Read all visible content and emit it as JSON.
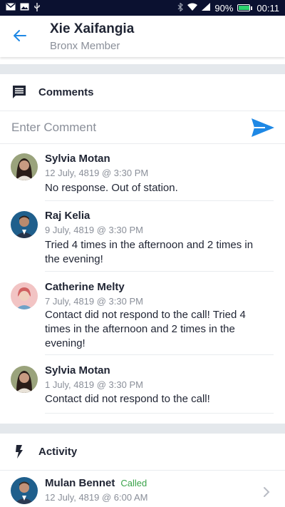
{
  "status_bar": {
    "battery": "90%",
    "time": "00:11",
    "icons": [
      "gmail-icon",
      "image-icon",
      "usb-icon",
      "bluetooth-icon",
      "wifi-icon",
      "signal-icon",
      "battery-icon"
    ],
    "battery_level": 0.9
  },
  "header": {
    "title": "Xie Xaifangia",
    "subtitle": "Bronx Member"
  },
  "comments_section": {
    "title": "Comments",
    "input_placeholder": "Enter Comment",
    "items": [
      {
        "name": "Sylvia Motan",
        "date": "12 July, 4819 @ 3:30 PM",
        "text": "No response. Out of station."
      },
      {
        "name": "Raj Kelia",
        "date": "9 July, 4819 @ 3:30 PM",
        "text": "Tried 4 times in the afternoon and 2 times in the evening!"
      },
      {
        "name": "Catherine Melty",
        "date": "7 July, 4819 @ 3:30 PM",
        "text": "Contact did not respond to the call! Tried 4 times in the afternoon and 2 times in the evening!"
      },
      {
        "name": "Sylvia Motan",
        "date": "1 July, 4819 @ 3:30 PM",
        "text": "Contact did not respond to the call!"
      }
    ]
  },
  "activity_section": {
    "title": "Activity",
    "items": [
      {
        "name": "Mulan Bennet",
        "status": "Called",
        "date": "12 July, 4819 @ 6:00 AM"
      }
    ]
  },
  "colors": {
    "accent": "#1e88e5",
    "called": "#3aa34a",
    "status_bar": "#0b1130",
    "band": "#e4e8ec"
  }
}
